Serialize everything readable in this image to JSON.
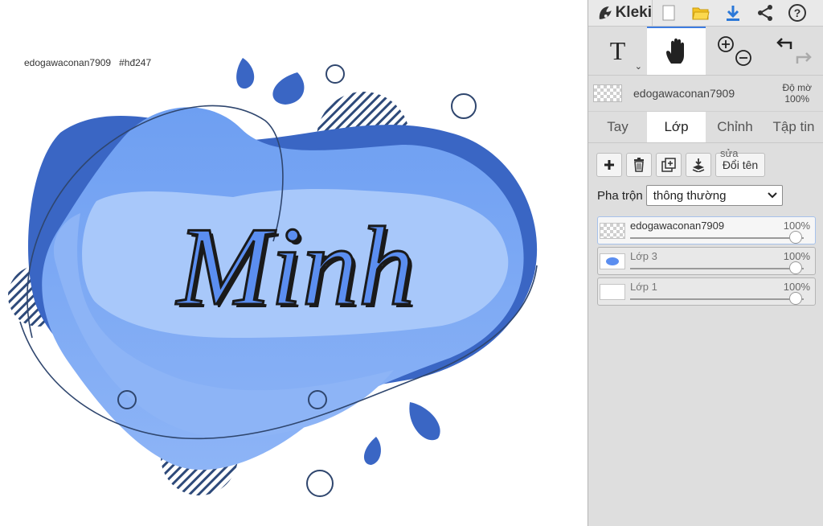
{
  "app": {
    "name": "Kleki"
  },
  "canvas": {
    "signature": "edogawaconan7909",
    "hashtag": "#hđ247",
    "artwork_text": "Minh"
  },
  "toolbar": {
    "icons": [
      "new-file-icon",
      "open-folder-icon",
      "download-icon",
      "share-icon",
      "help-icon"
    ]
  },
  "tools": {
    "text_label": "T",
    "icons": [
      "text-tool-icon",
      "hand-tool-icon",
      "zoom-in-icon",
      "zoom-out-icon",
      "undo-icon",
      "redo-icon"
    ]
  },
  "current_layer": {
    "name": "edogawaconan7909",
    "opacity_label": "Độ mờ",
    "opacity_value": "100%"
  },
  "tabs": [
    {
      "label": "Tay",
      "active": false
    },
    {
      "label": "Lớp",
      "active": true
    },
    {
      "label": "Chỉnh",
      "active": false
    },
    {
      "label": "Tập tin",
      "active": false
    }
  ],
  "layer_actions": {
    "rename_label": "Đổi tên",
    "rename_overlap": "sửa"
  },
  "blend": {
    "label": "Pha trộn",
    "value": "thông thường"
  },
  "layers": [
    {
      "name": "edogawaconan7909",
      "opacity": "100%",
      "opacity_fraction": 1.0,
      "selected": true
    },
    {
      "name": "Lớp 3",
      "opacity": "100%",
      "opacity_fraction": 1.0,
      "selected": false
    },
    {
      "name": "Lớp 1",
      "opacity": "100%",
      "opacity_fraction": 1.0,
      "selected": false
    }
  ],
  "colors": {
    "accent": "#3d7ce0",
    "art_blue_dark": "#3a66c4",
    "art_blue_mid": "#5b8ef0",
    "art_blue_light": "#8db4f6",
    "art_blue_pale": "#a8c8fa"
  }
}
